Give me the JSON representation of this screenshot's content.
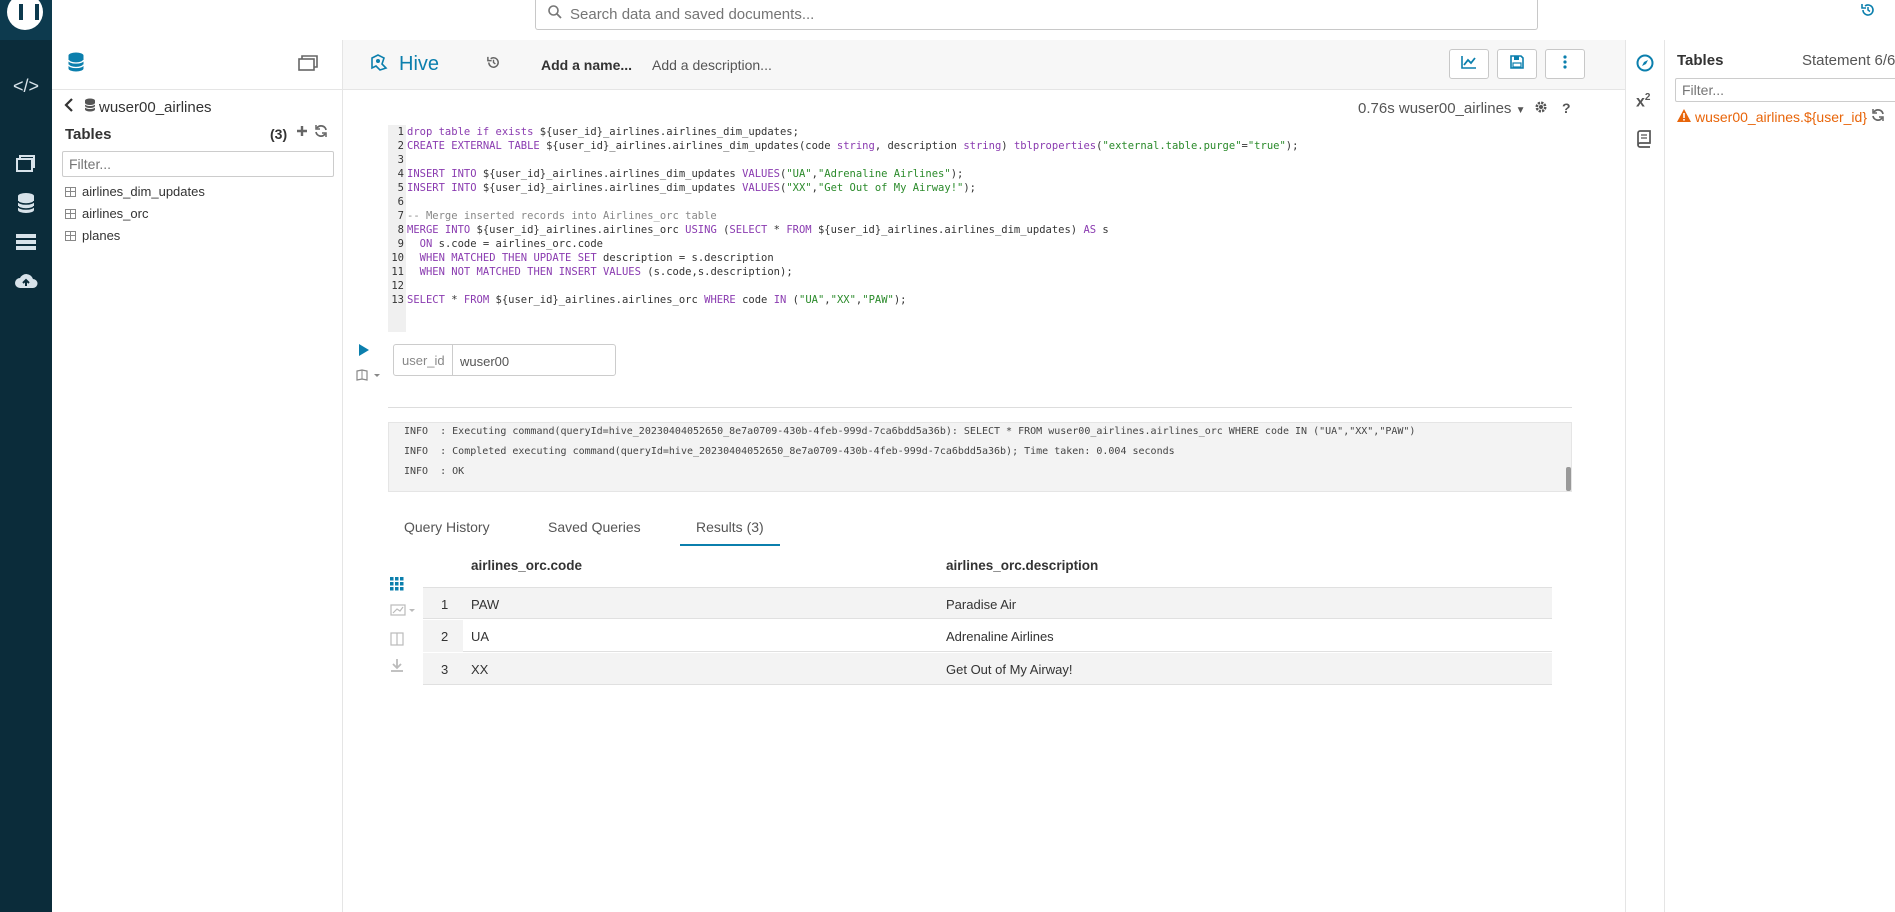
{
  "colors": {
    "accent": "#0b7fad",
    "nav_bg": "#0b2c3a",
    "warning": "#e8650a"
  },
  "topbar": {
    "search_placeholder": "Search data and saved documents..."
  },
  "nav": {
    "icons": [
      "editor-icon",
      "documents-icon",
      "tables-icon",
      "jobs-icon",
      "importer-icon"
    ]
  },
  "left_panel": {
    "back_icon": "chevron-left-icon",
    "database": "wuser00_airlines",
    "tables_label": "Tables",
    "tables_count": "(3)",
    "filter_placeholder": "Filter...",
    "tables": [
      "airlines_dim_updates",
      "airlines_orc",
      "planes"
    ]
  },
  "editor": {
    "type": "Hive",
    "name_placeholder": "Add a name...",
    "description_placeholder": "Add a description...",
    "meta": "0.76s wuser00_airlines",
    "code_lines": [
      "drop table if exists ${user_id}_airlines.airlines_dim_updates;",
      "CREATE EXTERNAL TABLE ${user_id}_airlines.airlines_dim_updates(code string, description string) tblproperties(\"external.table.purge\"=\"true\");",
      "",
      "INSERT INTO ${user_id}_airlines.airlines_dim_updates VALUES(\"UA\",\"Adrenaline Airlines\");",
      "INSERT INTO ${user_id}_airlines.airlines_dim_updates VALUES(\"XX\",\"Get Out of My Airway!\");",
      "",
      "-- Merge inserted records into Airlines_orc table",
      "MERGE INTO ${user_id}_airlines.airlines_orc USING (SELECT * FROM ${user_id}_airlines.airlines_dim_updates) AS s",
      "  ON s.code = airlines_orc.code",
      "  WHEN MATCHED THEN UPDATE SET description = s.description",
      "  WHEN NOT MATCHED THEN INSERT VALUES (s.code,s.description);",
      "",
      "SELECT * FROM ${user_id}_airlines.airlines_orc WHERE code IN (\"UA\",\"XX\",\"PAW\");"
    ],
    "param_name": "user_id",
    "param_value": "wuser00"
  },
  "log": [
    "INFO  : Executing command(queryId=hive_20230404052650_8e7a0709-430b-4feb-999d-7ca6bdd5a36b): SELECT * FROM wuser00_airlines.airlines_orc WHERE code IN (\"UA\",\"XX\",\"PAW\")",
    "INFO  : Completed executing command(queryId=hive_20230404052650_8e7a0709-430b-4feb-999d-7ca6bdd5a36b); Time taken: 0.004 seconds",
    "INFO  : OK"
  ],
  "tabs": [
    "Query History",
    "Saved Queries",
    "Results (3)"
  ],
  "results": {
    "columns": [
      "airlines_orc.code",
      "airlines_orc.description"
    ],
    "rows": [
      {
        "num": "1",
        "code": "PAW",
        "description": "Paradise Air"
      },
      {
        "num": "2",
        "code": "UA",
        "description": "Adrenaline Airlines"
      },
      {
        "num": "3",
        "code": "XX",
        "description": "Get Out of My Airway!"
      }
    ]
  },
  "right_panel": {
    "title": "Tables",
    "statement": "Statement 6/6",
    "filter_placeholder": "Filter...",
    "item": "wuser00_airlines.${user_id}"
  }
}
